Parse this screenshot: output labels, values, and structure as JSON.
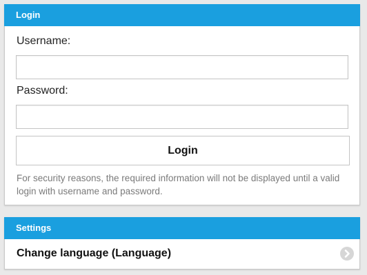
{
  "login": {
    "header": "Login",
    "username_label": "Username:",
    "username_value": "",
    "password_label": "Password:",
    "password_value": "",
    "login_button": "Login",
    "note": "For security reasons, the required information will not be displayed until a valid login with username and password."
  },
  "settings": {
    "header": "Settings",
    "items": [
      {
        "label": "Change language (Language)",
        "icon": "chevron-right-icon"
      }
    ]
  },
  "colors": {
    "header_bg": "#1a9fdf",
    "page_bg": "#e9e9e9"
  }
}
